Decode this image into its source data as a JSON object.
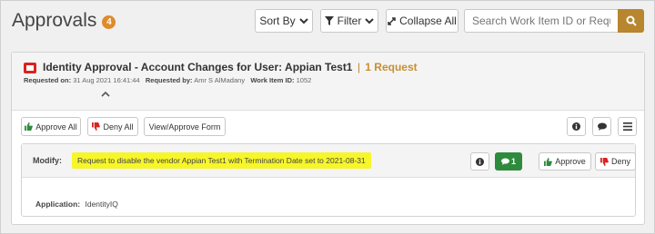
{
  "header": {
    "title": "Approvals",
    "count": "4",
    "sort_label": "Sort By",
    "filter_label": "Filter",
    "collapse_label": "Collapse All",
    "search_placeholder": "Search Work Item ID or Requester"
  },
  "item": {
    "title": "Identity Approval - Account Changes for User: Appian Test1",
    "separator": "|",
    "request_count": "1 Request",
    "requested_on_label": "Requested on:",
    "requested_on": "31 Aug 2021 16:41:44",
    "requested_by_label": "Requested by:",
    "requested_by": "Amr S AlMadany",
    "work_item_label": "Work Item ID:",
    "work_item_id": "1052"
  },
  "toolbar": {
    "approve_all": "Approve All",
    "deny_all": "Deny All",
    "view_form": "View/Approve Form"
  },
  "request": {
    "modify_label": "Modify:",
    "description": "Request to disable the vendor Appian Test1 with Termination Date set to 2021-08-31",
    "comment_count": "1",
    "approve": "Approve",
    "deny": "Deny",
    "application_label": "Application:",
    "application": "IdentityIQ"
  },
  "colors": {
    "accent": "#b8862e",
    "approve_green": "#2e8b3d",
    "deny_red": "#d9231f",
    "highlight": "#f7f62a"
  }
}
